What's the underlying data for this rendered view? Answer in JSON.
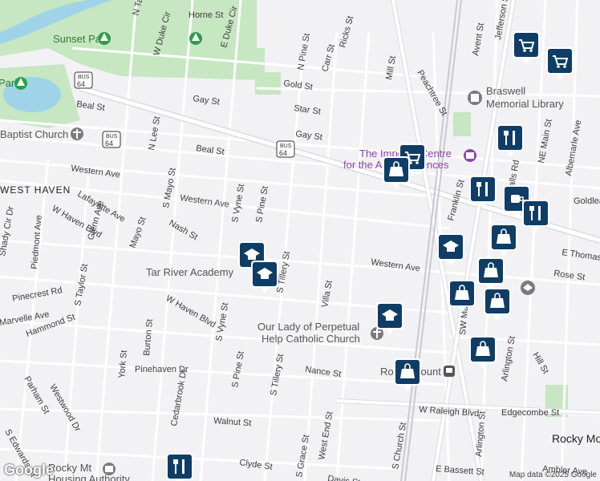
{
  "colors": {
    "background": "#f2f1f4",
    "road": "#ffffff",
    "major_road": "#dadce3",
    "rail": "#c9c9d2",
    "park": "#c7e6c2",
    "water": "#9fd4e8",
    "marker": "#0f3d66",
    "park_icon": "#2e9e4a",
    "purple": "#8e44ad"
  },
  "streets": [
    {
      "name": "Horne St"
    },
    {
      "name": "W Duke Cir"
    },
    {
      "name": "E Duke Cir"
    },
    {
      "name": "N Taylor St"
    },
    {
      "name": "Ricks St"
    },
    {
      "name": "Carr St"
    },
    {
      "name": "N Pine St"
    },
    {
      "name": "Mill St"
    },
    {
      "name": "Peachtree St"
    },
    {
      "name": "Avent St"
    },
    {
      "name": "Jefferson St"
    },
    {
      "name": "Gold St"
    },
    {
      "name": "Gay St"
    },
    {
      "name": "Star St"
    },
    {
      "name": "Gay St"
    },
    {
      "name": "Beal St"
    },
    {
      "name": "Beal St"
    },
    {
      "name": "N Lee St"
    },
    {
      "name": "Western Ave"
    },
    {
      "name": "Western Ave"
    },
    {
      "name": "Western Ave"
    },
    {
      "name": "S Mayo St"
    },
    {
      "name": "Lafayette Ave"
    },
    {
      "name": "Nash St"
    },
    {
      "name": "S Vyne St"
    },
    {
      "name": "S Pine St"
    },
    {
      "name": "W Haven Blvd"
    },
    {
      "name": "Glenn Ave"
    },
    {
      "name": "Mayo St"
    },
    {
      "name": "Piedmont Ave"
    },
    {
      "name": "Shady Cir Dr"
    },
    {
      "name": "Pinecrest Rd"
    },
    {
      "name": "S Taylor St"
    },
    {
      "name": "W Haven Blvd"
    },
    {
      "name": "Marvelle Ave"
    },
    {
      "name": "Hammond St"
    },
    {
      "name": "Westwood Dr"
    },
    {
      "name": "Parham St"
    },
    {
      "name": "Burton St"
    },
    {
      "name": "York St"
    },
    {
      "name": "Pinehaven Dr"
    },
    {
      "name": "Cedarbrook Dr"
    },
    {
      "name": "S Edwards St"
    },
    {
      "name": "S Vyne St"
    },
    {
      "name": "S Pine St"
    },
    {
      "name": "S Tillery St"
    },
    {
      "name": "S Tillery St"
    },
    {
      "name": "Villa St"
    },
    {
      "name": "Nance St"
    },
    {
      "name": "Walnut St"
    },
    {
      "name": "W Raleigh Blvd"
    },
    {
      "name": "Edgecombe St"
    },
    {
      "name": "Arlington St"
    },
    {
      "name": "Arlington St"
    },
    {
      "name": "Hill St"
    },
    {
      "name": "Rose St"
    },
    {
      "name": "E Thomas St"
    },
    {
      "name": "Goldleaf St"
    },
    {
      "name": "NE Main St"
    },
    {
      "name": "Falls Rd"
    },
    {
      "name": "Albemarle Ave"
    },
    {
      "name": "Franklin St"
    },
    {
      "name": "SW Main St"
    },
    {
      "name": "S Grace St"
    },
    {
      "name": "West End St"
    },
    {
      "name": "Clyde St"
    },
    {
      "name": "E Bassett St"
    },
    {
      "name": "Ambler Ave"
    },
    {
      "name": "S Church St"
    },
    {
      "name": "Davis St"
    }
  ],
  "route_shields": [
    {
      "text": "64",
      "top": "BUS"
    },
    {
      "text": "64",
      "top": "BUS"
    },
    {
      "text": "64",
      "top": "BUS"
    }
  ],
  "places": {
    "sunset_park": "Sunset Park",
    "park_left": "Park",
    "baptist_church": "Baptist Church",
    "braswell_line1": "Braswell",
    "braswell_line2": "Memorial Library",
    "imperial_line1": "The Imperial Centre",
    "imperial_line2": "for the Arts & Sciences",
    "west_haven": "WEST HAVEN",
    "tar_river_academy": "Tar River Academy",
    "our_lady_line1": "Our Lady of Perpetual",
    "our_lady_line2": "Help Catholic Church",
    "rocky_mount_station": "Rocky Mount",
    "rocky_mount_city": "Rocky Mount",
    "housing_line1": "Rocky Mt",
    "housing_line2": "Housing Authority"
  },
  "markers": [
    {
      "type": "cart-icon"
    },
    {
      "type": "cart-icon"
    },
    {
      "type": "cart-icon"
    },
    {
      "type": "bag-icon"
    },
    {
      "type": "fork-knife-icon"
    },
    {
      "type": "fork-knife-icon"
    },
    {
      "type": "coffee-icon"
    },
    {
      "type": "fork-knife-icon"
    },
    {
      "type": "school-icon"
    },
    {
      "type": "school-icon"
    },
    {
      "type": "school-icon"
    },
    {
      "type": "bag-icon"
    },
    {
      "type": "bag-icon"
    },
    {
      "type": "bag-icon"
    },
    {
      "type": "bag-icon"
    },
    {
      "type": "bag-icon"
    },
    {
      "type": "school-icon"
    },
    {
      "type": "bag-icon"
    },
    {
      "type": "fork-knife-icon"
    }
  ],
  "attribution": "Map data ©2025 Google",
  "logo": "Google"
}
